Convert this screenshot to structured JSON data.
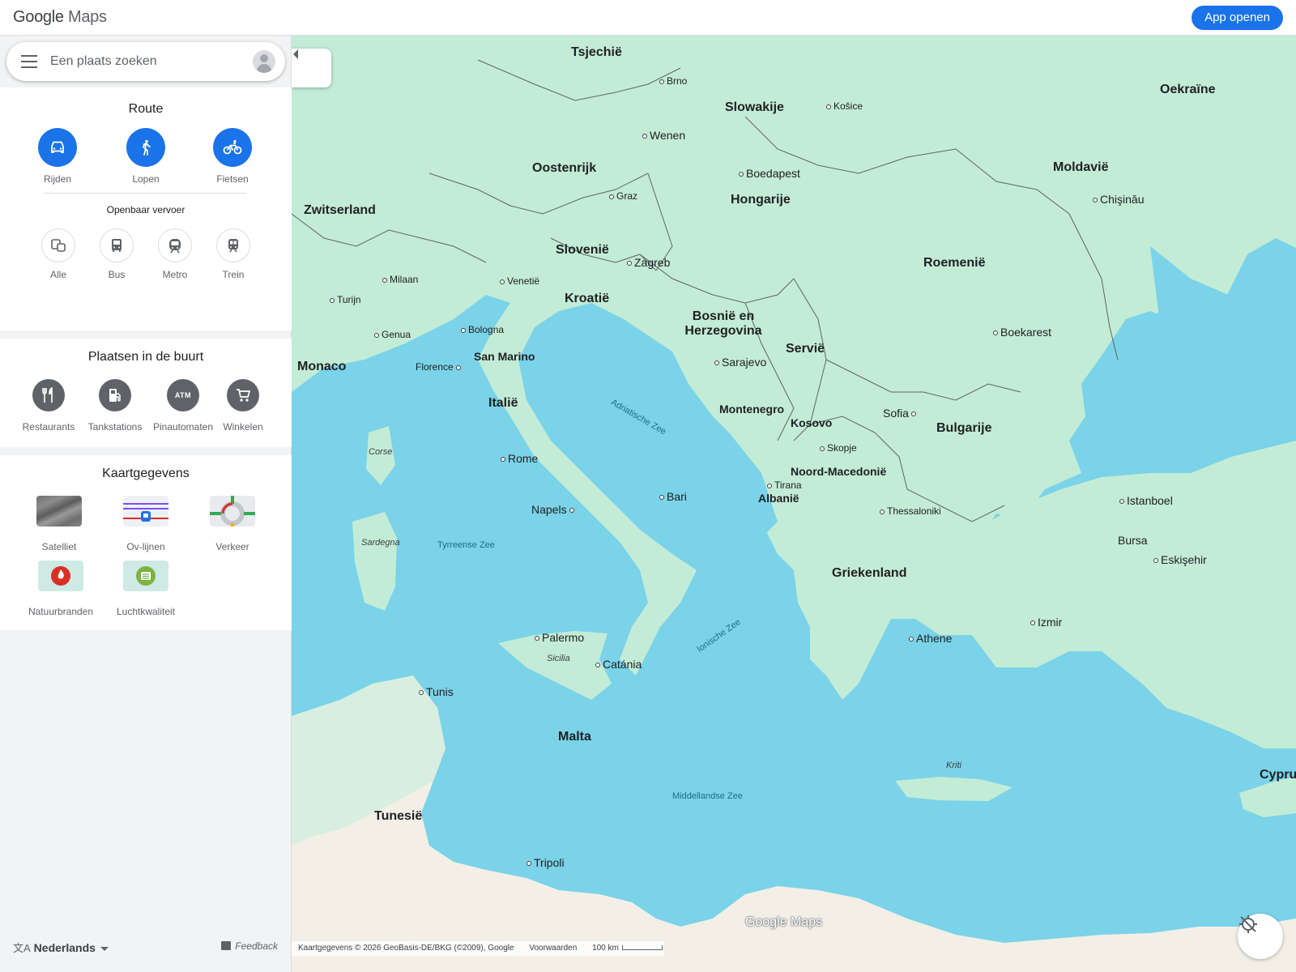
{
  "header": {
    "logo_google": "Google",
    "logo_maps": "Maps",
    "open_app_label": "App openen"
  },
  "search": {
    "placeholder": "Een plaats zoeken"
  },
  "route": {
    "title": "Route",
    "modes": [
      {
        "label": "Rijden",
        "icon": "car-icon"
      },
      {
        "label": "Lopen",
        "icon": "walk-icon"
      },
      {
        "label": "Fietsen",
        "icon": "bike-icon"
      }
    ],
    "transit_title": "Openbaar vervoer",
    "transit": [
      {
        "label": "Alle",
        "icon": "transit-all-icon"
      },
      {
        "label": "Bus",
        "icon": "bus-icon"
      },
      {
        "label": "Metro",
        "icon": "metro-icon"
      },
      {
        "label": "Trein",
        "icon": "train-icon"
      }
    ]
  },
  "nearby": {
    "title": "Plaatsen in de buurt",
    "items": [
      {
        "label": "Restaurants",
        "icon": "restaurant-icon"
      },
      {
        "label": "Tankstations",
        "icon": "gas-station-icon"
      },
      {
        "label": "Pinautomaten",
        "icon": "atm-icon",
        "glyph": "ATM"
      },
      {
        "label": "Winkelen",
        "icon": "shopping-cart-icon"
      }
    ]
  },
  "layers": {
    "title": "Kaartgegevens",
    "items": [
      {
        "label": "Satelliet",
        "icon": "satellite-icon"
      },
      {
        "label": "Ov-lijnen",
        "icon": "transit-lines-icon"
      },
      {
        "label": "Verkeer",
        "icon": "traffic-icon"
      },
      {
        "label": "Natuurbranden",
        "icon": "wildfire-icon"
      },
      {
        "label": "Luchtkwaliteit",
        "icon": "air-quality-icon"
      }
    ]
  },
  "footer": {
    "language": "Nederlands",
    "feedback": "Feedback"
  },
  "map": {
    "watermark": "Google Maps",
    "attribution": "Kaartgegevens © 2026 GeoBasis-DE/BKG (©2009), Google",
    "terms": "Voorwaarden",
    "scale": "100 km",
    "colors": {
      "water": "#7ad3e8",
      "land": "#c3ecd6",
      "desert": "#f3efe7"
    },
    "labels": {
      "countries": [
        "Tsjechië",
        "Slowakije",
        "Oostenrijk",
        "Hongarije",
        "Zwitserland",
        "Slovenië",
        "Kroatië",
        "Roemenië",
        "Moldavië",
        "Oekraïne",
        "Bosnië en Herzegovina",
        "Servië",
        "Monaco",
        "San Marino",
        "Italië",
        "Montenegro",
        "Kosovo",
        "Bulgarije",
        "Noord-Macedonië",
        "Albanië",
        "Griekenland",
        "Malta",
        "Tunesië",
        "Cyprus"
      ],
      "cities": [
        "Wenen",
        "Boedapest",
        "Zagreb",
        "Sarajevo",
        "Rome",
        "Bari",
        "Napels",
        "Palermo",
        "Catánia",
        "Tunis",
        "Athene",
        "Sofia",
        "Boekarest",
        "Chişinău",
        "Istanboel",
        "Bursa",
        "Eskişehir",
        "Izmir",
        "Thessaloniki",
        "Tripoli",
        "Skopje",
        "Tirana",
        "Florence",
        "Bologna",
        "Genua",
        "Milaan",
        "Turijn",
        "Venetië",
        "Graz",
        "Brno",
        "Košice"
      ],
      "seas": [
        "Adriatische Zee",
        "Tyrreense Zee",
        "Ionische Zee",
        "Middellandse Zee"
      ],
      "islands": [
        "Corse",
        "Sardegna",
        "Sicilia",
        "Kriti"
      ]
    }
  }
}
